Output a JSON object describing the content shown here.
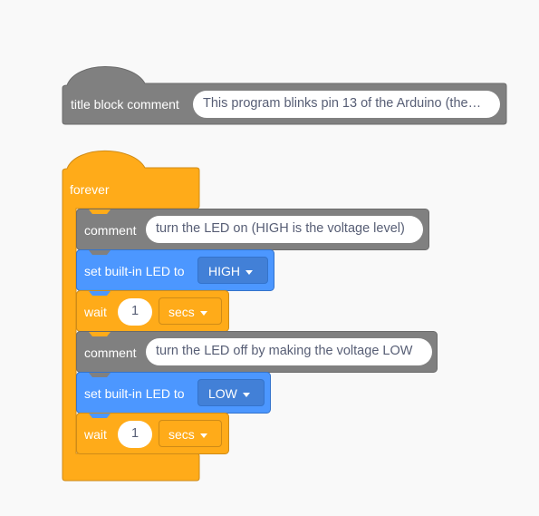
{
  "hat": {
    "label": "title block comment",
    "value": "This program blinks pin 13 of the Arduino (the…"
  },
  "forever": {
    "label": "forever"
  },
  "blocks": [
    {
      "type": "comment",
      "label": "comment",
      "value": "turn the LED on (HIGH is the voltage level)"
    },
    {
      "type": "led",
      "label": "set built-in LED to",
      "value": "HIGH"
    },
    {
      "type": "wait",
      "label": "wait",
      "value": "1",
      "unit": "secs"
    },
    {
      "type": "comment",
      "label": "comment",
      "value": "turn the LED off by making the voltage LOW"
    },
    {
      "type": "led",
      "label": "set built-in LED to",
      "value": "LOW"
    },
    {
      "type": "wait",
      "label": "wait",
      "value": "1",
      "unit": "secs"
    }
  ],
  "colors": {
    "comment_fill": "#808080",
    "comment_border": "#6b6b6b",
    "control_fill": "#ffab19",
    "control_border": "#cf8b17",
    "led_fill": "#4c97ff",
    "led_border": "#3373cc",
    "background": "#f9f9f9"
  },
  "icons": {
    "dropdown": "dropdown-caret-icon"
  }
}
